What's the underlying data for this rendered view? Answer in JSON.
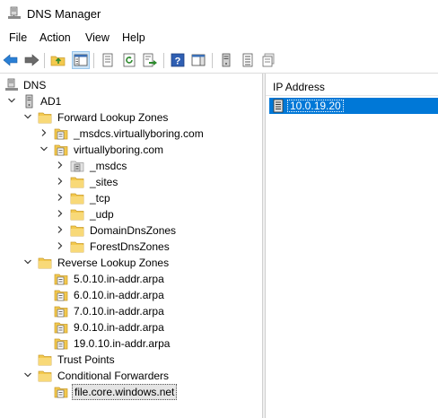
{
  "window": {
    "title": "DNS Manager",
    "app_icon": "dns-server-icon"
  },
  "menu": [
    "File",
    "Action",
    "View",
    "Help"
  ],
  "toolbar": {
    "buttons": [
      "back-icon",
      "forward-icon",
      "up-folder-icon",
      "show-hide-console-tree-icon",
      "properties-icon",
      "refresh-icon",
      "export-list-icon",
      "help-icon",
      "show-hide-action-pane-icon",
      "dns-server-icon",
      "zone-icon",
      "domain-icon"
    ]
  },
  "tree": {
    "root": "DNS",
    "server": "AD1",
    "forward_zones": "Forward Lookup Zones",
    "msdcs_zone": "_msdcs.virtuallyboring.com",
    "main_zone": "virtuallyboring.com",
    "sub": [
      "_msdcs",
      "_sites",
      "_tcp",
      "_udp",
      "DomainDnsZones",
      "ForestDnsZones"
    ],
    "reverse_zones": "Reverse Lookup Zones",
    "reverse": [
      "5.0.10.in-addr.arpa",
      "6.0.10.in-addr.arpa",
      "7.0.10.in-addr.arpa",
      "9.0.10.in-addr.arpa",
      "19.0.10.in-addr.arpa"
    ],
    "trust_points": "Trust Points",
    "conditional_forwarders": "Conditional Forwarders",
    "forwarder": "file.core.windows.net"
  },
  "list": {
    "column_header": "IP Address",
    "rows": [
      "10.0.19.20"
    ]
  },
  "colors": {
    "selection": "#0078d7",
    "folder": "#f3c94e",
    "folder_dark": "#d9a431"
  }
}
